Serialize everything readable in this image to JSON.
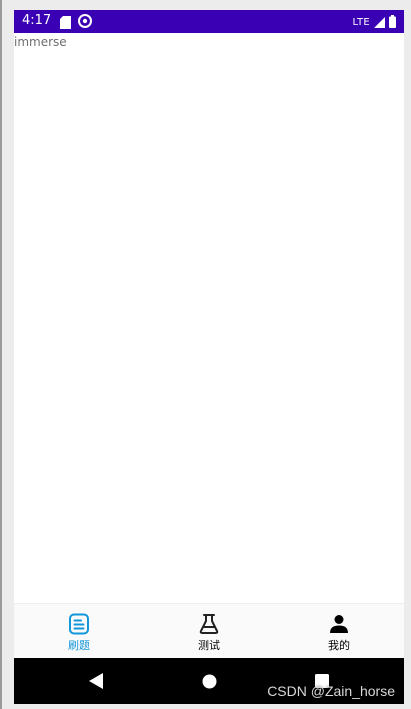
{
  "status_bar": {
    "time": "4:17",
    "network": "LTE",
    "background_color": "#3a00b3",
    "icons": [
      "sd-card-icon",
      "do-not-disturb-icon",
      "signal-icon",
      "battery-icon"
    ]
  },
  "content": {
    "label": "immerse"
  },
  "bottom_nav": {
    "items": [
      {
        "label": "刷题",
        "icon": "document-icon",
        "active": true
      },
      {
        "label": "测试",
        "icon": "flask-icon",
        "active": false
      },
      {
        "label": "我的",
        "icon": "person-icon",
        "active": false
      }
    ],
    "active_color": "#1296db",
    "inactive_color": "#000000"
  },
  "system_nav": {
    "buttons": [
      "back-icon",
      "home-icon",
      "recents-icon"
    ]
  },
  "watermark": {
    "text": "CSDN @Zain_horse"
  }
}
